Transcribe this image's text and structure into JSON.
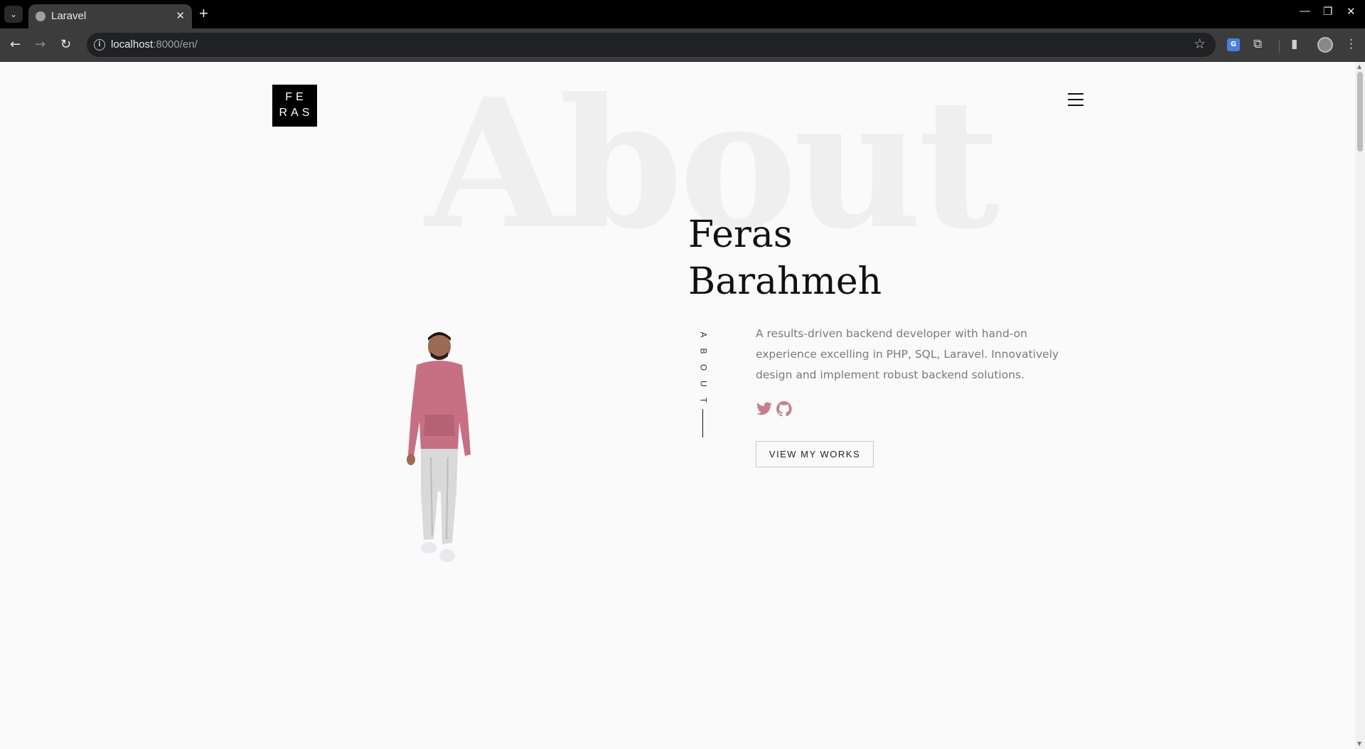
{
  "browser": {
    "tab_title": "Laravel",
    "new_tab": "+",
    "url_host": "localhost",
    "url_rest": ":8000/en/",
    "translate_badge": "G"
  },
  "page": {
    "bg_word": "About",
    "logo_line1": "FE",
    "logo_line2": "RAS",
    "name_line1": "Feras",
    "name_line2": "Barahmeh",
    "section_label": [
      "A",
      "B",
      "O",
      "U",
      "T"
    ],
    "description": "A results-driven backend developer with hand-on experience excelling in PHP, SQL, Laravel. Innovatively design and implement robust backend solutions.",
    "social_icons": [
      "twitter-icon",
      "github-icon"
    ],
    "accent_color": "#c4808e",
    "works_button": "VIEW MY WORKS"
  }
}
